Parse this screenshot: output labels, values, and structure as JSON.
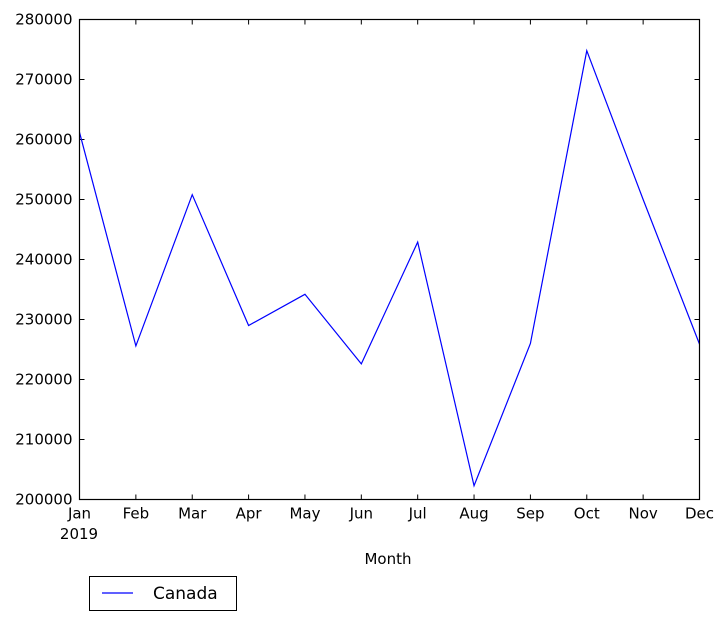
{
  "chart_data": {
    "type": "line",
    "title": "",
    "xlabel": "Month",
    "ylabel": "",
    "categories": [
      "Jan",
      "Feb",
      "Mar",
      "Apr",
      "May",
      "Jun",
      "Jul",
      "Aug",
      "Sep",
      "Oct",
      "Nov",
      "Dec"
    ],
    "x_sublabel": "2019",
    "ylim": [
      200000,
      280000
    ],
    "yticks": [
      200000,
      210000,
      220000,
      230000,
      240000,
      250000,
      260000,
      270000,
      280000
    ],
    "ytick_labels": [
      "200000",
      "210000",
      "220000",
      "230000",
      "240000",
      "250000",
      "260000",
      "270000",
      "280000"
    ],
    "grid": false,
    "series": [
      {
        "name": "Canada",
        "color": "#0000ff",
        "values": [
          261200,
          225600,
          250800,
          229000,
          234200,
          222600,
          242900,
          202300,
          226000,
          274800,
          250000,
          225900
        ]
      }
    ],
    "legend": {
      "entries": [
        "Canada"
      ],
      "placement": "below-left"
    }
  }
}
